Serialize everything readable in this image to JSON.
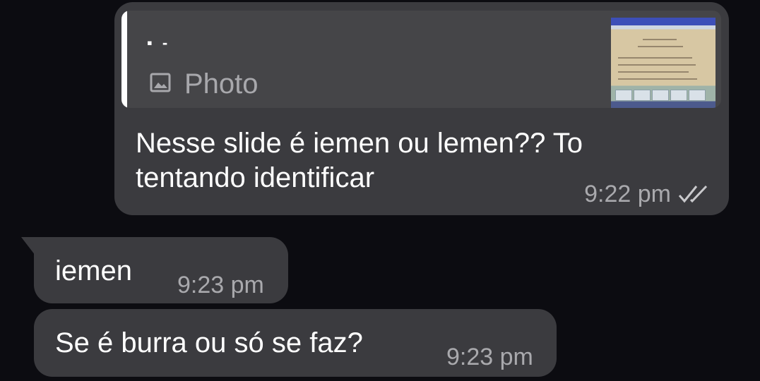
{
  "messages": {
    "outgoing": {
      "reply": {
        "author": "▪ -",
        "media_label": "Photo",
        "media_icon": "image-icon",
        "thumbnail_icon": "slide-thumbnail"
      },
      "text": "Nesse slide é iemen ou lemen?? To tentando identificar",
      "time": "9:22 pm",
      "status_icon": "double-check-icon"
    },
    "incoming": [
      {
        "text": "iemen",
        "time": "9:23 pm"
      },
      {
        "text": "Se é burra ou só se faz?",
        "time": "9:23 pm"
      }
    ]
  },
  "colors": {
    "background": "#0c0c11",
    "bubble": "#3b3b3f",
    "quote": "#454548",
    "meta_text": "#a9a9ad"
  }
}
